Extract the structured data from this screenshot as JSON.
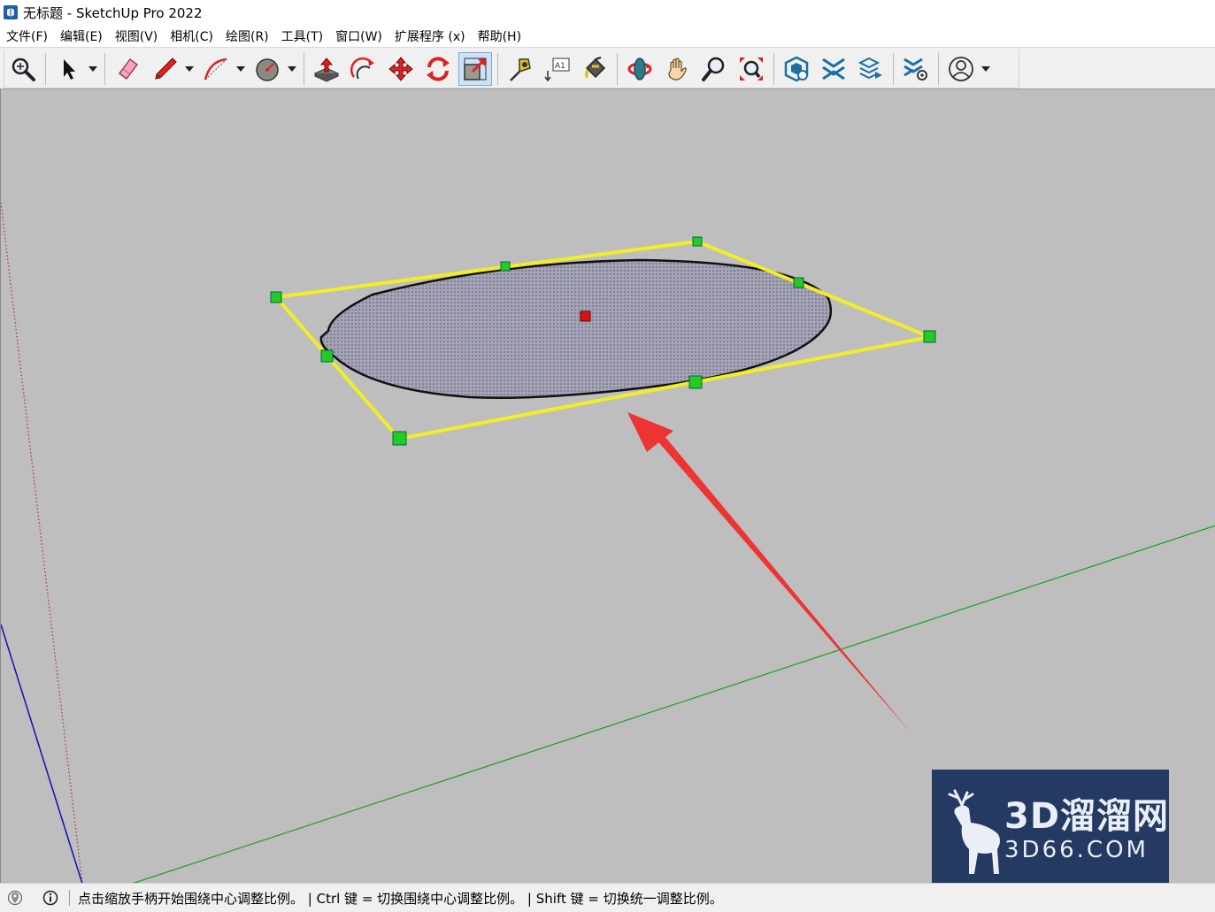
{
  "window": {
    "title": "无标题 - SketchUp Pro 2022",
    "app_icon": "sketchup-logo-icon"
  },
  "menu": {
    "items": [
      "文件(F)",
      "编辑(E)",
      "视图(V)",
      "相机(C)",
      "绘图(R)",
      "工具(T)",
      "窗口(W)",
      "扩展程序 (x)",
      "帮助(H)"
    ]
  },
  "toolbar": {
    "tools": [
      {
        "icon": "zoom-search-icon"
      },
      {
        "icon": "select-arrow-icon",
        "dropdown": true
      },
      {
        "icon": "eraser-icon"
      },
      {
        "icon": "pencil-line-icon",
        "dropdown": true
      },
      {
        "icon": "arc-icon",
        "dropdown": true
      },
      {
        "icon": "shape-circle-icon",
        "dropdown": true
      },
      {
        "icon": "push-pull-icon"
      },
      {
        "icon": "offset-icon"
      },
      {
        "icon": "move-icon"
      },
      {
        "icon": "rotate-icon"
      },
      {
        "icon": "scale-icon",
        "active": true
      },
      {
        "icon": "tape-measure-icon"
      },
      {
        "icon": "text-label-icon"
      },
      {
        "icon": "paint-bucket-icon"
      },
      {
        "icon": "orbit-icon"
      },
      {
        "icon": "pan-hand-icon"
      },
      {
        "icon": "zoom-icon"
      },
      {
        "icon": "zoom-extents-icon"
      },
      {
        "icon": "3d-warehouse-icon"
      },
      {
        "icon": "extension-warehouse-icon"
      },
      {
        "icon": "layout-send-icon"
      },
      {
        "icon": "extension-manager-icon"
      },
      {
        "icon": "user-account-icon",
        "dropdown": true
      }
    ]
  },
  "colors": {
    "viewport_bg": "#bebebe",
    "bbox_yellow": "#f2ee24",
    "grip_green": "#22cc22",
    "center_red": "#dd1111",
    "axis_green": "#1e9e1e",
    "axis_blue": "#1010b0",
    "axis_red_dotted": "#b03030",
    "arrow_red": "#ee3333",
    "ellipse_fill": "#9898aa"
  },
  "watermark": {
    "line1": "3D溜溜网",
    "line2": "3D66.COM"
  },
  "status": {
    "icons": [
      "geo-location-icon",
      "info-icon"
    ],
    "text": "点击缩放手柄开始围绕中心调整比例。 | Ctrl 键 = 切换围绕中心调整比例。 | Shift 键 = 切换统一调整比例。"
  }
}
